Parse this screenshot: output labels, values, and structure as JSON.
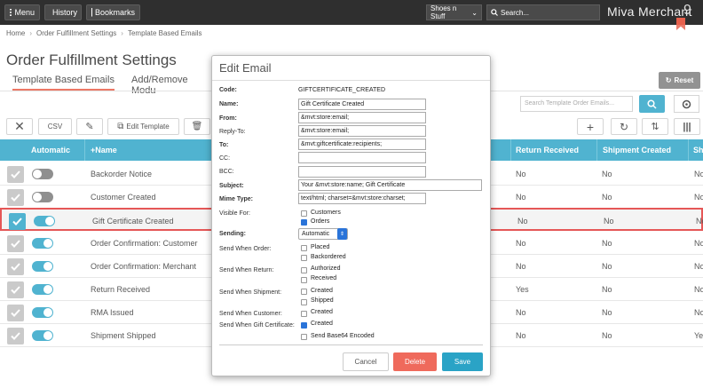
{
  "topbar": {
    "menu": "Menu",
    "history": "History",
    "bookmarks": "Bookmarks",
    "store": "Shoes n Stuff",
    "search": "Search...",
    "logo": "Miva Merchant"
  },
  "breadcrumb": [
    "Home",
    "Order Fulfillment Settings",
    "Template Based Emails"
  ],
  "page_title": "Order Fulfillment Settings",
  "tabs": [
    "Template Based Emails",
    "Add/Remove Modu"
  ],
  "reset": "Reset",
  "order_search_placeholder": "Search Template Order Emails...",
  "toolbar": {
    "csv": "CSV",
    "edit_template": "Edit Template"
  },
  "columns": {
    "automatic": "Automatic",
    "name": "+Name",
    "return_received": "Return Received",
    "shipment_created": "Shipment Created",
    "sh": "Sh"
  },
  "rows": [
    {
      "name": "Backorder Notice",
      "return": "No",
      "ship": "No",
      "x": "No",
      "auto": false,
      "checked": false
    },
    {
      "name": "Customer Created",
      "return": "No",
      "ship": "No",
      "x": "No",
      "auto": false,
      "checked": false
    },
    {
      "name": "Gift Certificate Created",
      "return": "No",
      "ship": "No",
      "x": "No",
      "auto": true,
      "checked": true
    },
    {
      "name": "Order Confirmation: Customer",
      "return": "No",
      "ship": "No",
      "x": "No",
      "auto": true,
      "checked": false
    },
    {
      "name": "Order Confirmation: Merchant",
      "return": "No",
      "ship": "No",
      "x": "No",
      "auto": true,
      "checked": false
    },
    {
      "name": "Return Received",
      "return": "Yes",
      "ship": "No",
      "x": "No",
      "auto": true,
      "checked": false
    },
    {
      "name": "RMA Issued",
      "return": "No",
      "ship": "No",
      "x": "No",
      "auto": true,
      "checked": false
    },
    {
      "name": "Shipment Shipped",
      "return": "No",
      "ship": "No",
      "x": "Ye",
      "auto": true,
      "checked": false
    }
  ],
  "modal": {
    "title": "Edit Email",
    "labels": {
      "code": "Code:",
      "name": "Name:",
      "from": "From:",
      "reply_to": "Reply-To:",
      "to": "To:",
      "cc": "CC:",
      "bcc": "BCC:",
      "subject": "Subject:",
      "mime": "Mime Type:",
      "visible_for": "Visible For:",
      "sending": "Sending:",
      "when_order": "Send When Order:",
      "when_return": "Send When Return:",
      "when_shipment": "Send When Shipment:",
      "when_customer": "Send When Customer:",
      "when_gift": "Send When Gift Certificate:"
    },
    "values": {
      "code": "GIFTCERTIFICATE_CREATED",
      "name": "Gift Certificate Created",
      "from": "&mvt:store:email;",
      "reply_to": "&mvt:store:email;",
      "to": "&mvt:giftcertificate:recipients;",
      "cc": "",
      "bcc": "",
      "subject": "Your &mvt:store:name; Gift Certificate",
      "mime": "text/html; charset=&mvt:store:charset;",
      "sending": "Automatic"
    },
    "checks": {
      "customers": "Customers",
      "orders": "Orders",
      "placed": "Placed",
      "backordered": "Backordered",
      "authorized": "Authorized",
      "received": "Received",
      "created_ship": "Created",
      "shipped": "Shipped",
      "created_cust": "Created",
      "created_gift": "Created",
      "base64": "Send Base64 Encoded"
    },
    "buttons": {
      "cancel": "Cancel",
      "delete": "Delete",
      "save": "Save"
    }
  },
  "colors": {
    "accent": "#2aa3c6",
    "delete": "#ef6a5c",
    "save": "#2aa3c6",
    "highlight": "#e03333"
  }
}
